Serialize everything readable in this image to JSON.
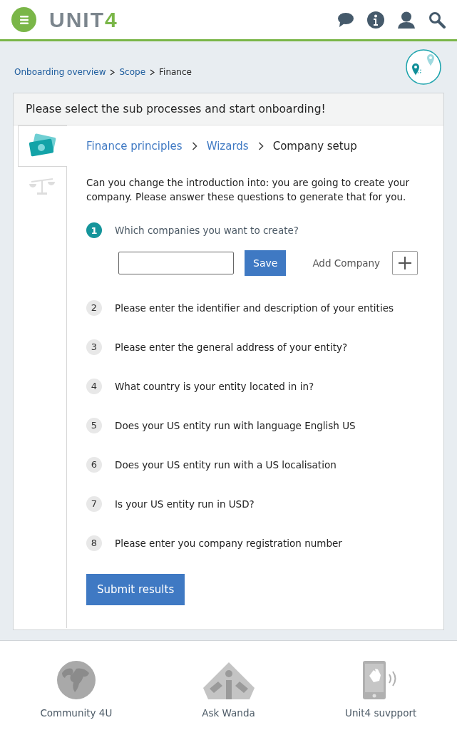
{
  "header": {
    "logo": {
      "text": "UNIT",
      "accent": "4"
    }
  },
  "breadcrumb": [
    {
      "label": "Onboarding overview",
      "link": true
    },
    {
      "label": "Scope",
      "link": true
    },
    {
      "label": "Finance",
      "link": false
    }
  ],
  "card": {
    "title": "Please select the sub processes and start onboarding!",
    "side_tabs": [
      {
        "kind": "money",
        "selected": true
      },
      {
        "kind": "scale",
        "selected": false
      }
    ],
    "wizard_breadcrumb": [
      {
        "label": "Finance principles",
        "link": true
      },
      {
        "label": "Wizards",
        "link": true
      },
      {
        "label": "Company setup",
        "link": false
      }
    ],
    "intro": "Can you change the introduction into: you are going to create your company. Please answer these questions to generate that for you.",
    "steps": [
      {
        "number": "1",
        "question": "Which companies you want to create?",
        "selected": true
      },
      {
        "number": "2",
        "question": "Please enter the identifier and description of your entities",
        "selected": false
      },
      {
        "number": "3",
        "question": "Please enter the general address of your entity?",
        "selected": false
      },
      {
        "number": "4",
        "question": "What country is your entity located in in?",
        "selected": false
      },
      {
        "number": "5",
        "question": "Does your US entity run with language English US",
        "selected": false
      },
      {
        "number": "6",
        "question": "Does your US entity run with a US localisation",
        "selected": false
      },
      {
        "number": "7",
        "question": "Is your US entity run in  USD?",
        "selected": false
      },
      {
        "number": "8",
        "question": "Please enter you company registration number",
        "selected": false
      }
    ],
    "save_button": "Save",
    "add_company": "Add Company",
    "submit_button": "Submit results"
  },
  "footer": [
    {
      "kind": "globe",
      "label": "Community 4U"
    },
    {
      "kind": "wanda",
      "label": "Ask Wanda"
    },
    {
      "kind": "phone",
      "label": "Unit4 suvpport"
    }
  ]
}
